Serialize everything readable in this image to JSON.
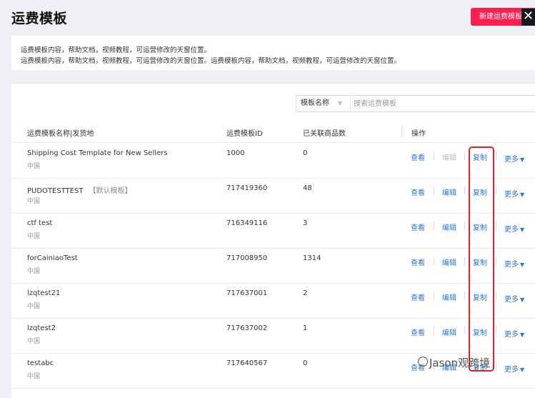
{
  "header": {
    "title": "运费模板",
    "new_button_label": "新建运费模板",
    "close_glyph": "✕"
  },
  "notice": {
    "line1": "运费模板内容，帮助文档，视频教程，可运营修改的天窗位置。",
    "line2": "运费模板内容，帮助文档，视频教程，可运营修改的天窗位置。运费模板内容，帮助文档，视频教程，可运营修改的天窗位置。"
  },
  "search": {
    "select_value": "模板名称",
    "placeholder": "搜索运费模板"
  },
  "table": {
    "columns": [
      "运费模板名称|发货地",
      "运费模板ID",
      "已关联商品数",
      "操作"
    ],
    "rows": [
      {
        "name": "Shipping Cost Template for New Sellers",
        "tag": "",
        "location": "中国",
        "id": "1000",
        "count": "0",
        "view": "查看",
        "edit": "编辑",
        "edit_disabled": true,
        "copy": "复制",
        "more": "更多"
      },
      {
        "name": "PUDOTESTTEST",
        "tag": "【默认模板】",
        "location": "中国",
        "id": "717419360",
        "count": "48",
        "view": "查看",
        "edit": "编辑",
        "edit_disabled": false,
        "copy": "复制",
        "more": "更多"
      },
      {
        "name": "ctf test",
        "tag": "",
        "location": "中国",
        "id": "716349116",
        "count": "3",
        "view": "查看",
        "edit": "编辑",
        "edit_disabled": false,
        "copy": "复制",
        "more": "更多"
      },
      {
        "name": "forCainiaoTest",
        "tag": "",
        "location": "中国",
        "id": "717008950",
        "count": "1314",
        "view": "查看",
        "edit": "编辑",
        "edit_disabled": false,
        "copy": "复制",
        "more": "更多"
      },
      {
        "name": "lzqtest21",
        "tag": "",
        "location": "中国",
        "id": "717637001",
        "count": "2",
        "view": "查看",
        "edit": "编辑",
        "edit_disabled": false,
        "copy": "复制",
        "more": "更多"
      },
      {
        "name": "lzqtest2",
        "tag": "",
        "location": "中国",
        "id": "717637002",
        "count": "1",
        "view": "查看",
        "edit": "编辑",
        "edit_disabled": false,
        "copy": "复制",
        "more": "更多"
      },
      {
        "name": "testabc",
        "tag": "",
        "location": "中国",
        "id": "717640567",
        "count": "0",
        "view": "查看",
        "edit": "编辑",
        "edit_disabled": false,
        "copy": "复制",
        "more": "更多"
      }
    ]
  },
  "watermark": {
    "text": "Jason观跨境"
  },
  "colors": {
    "accent": "#ff1f4f",
    "link": "#2d75d8",
    "highlight_box": "#e0202a"
  }
}
